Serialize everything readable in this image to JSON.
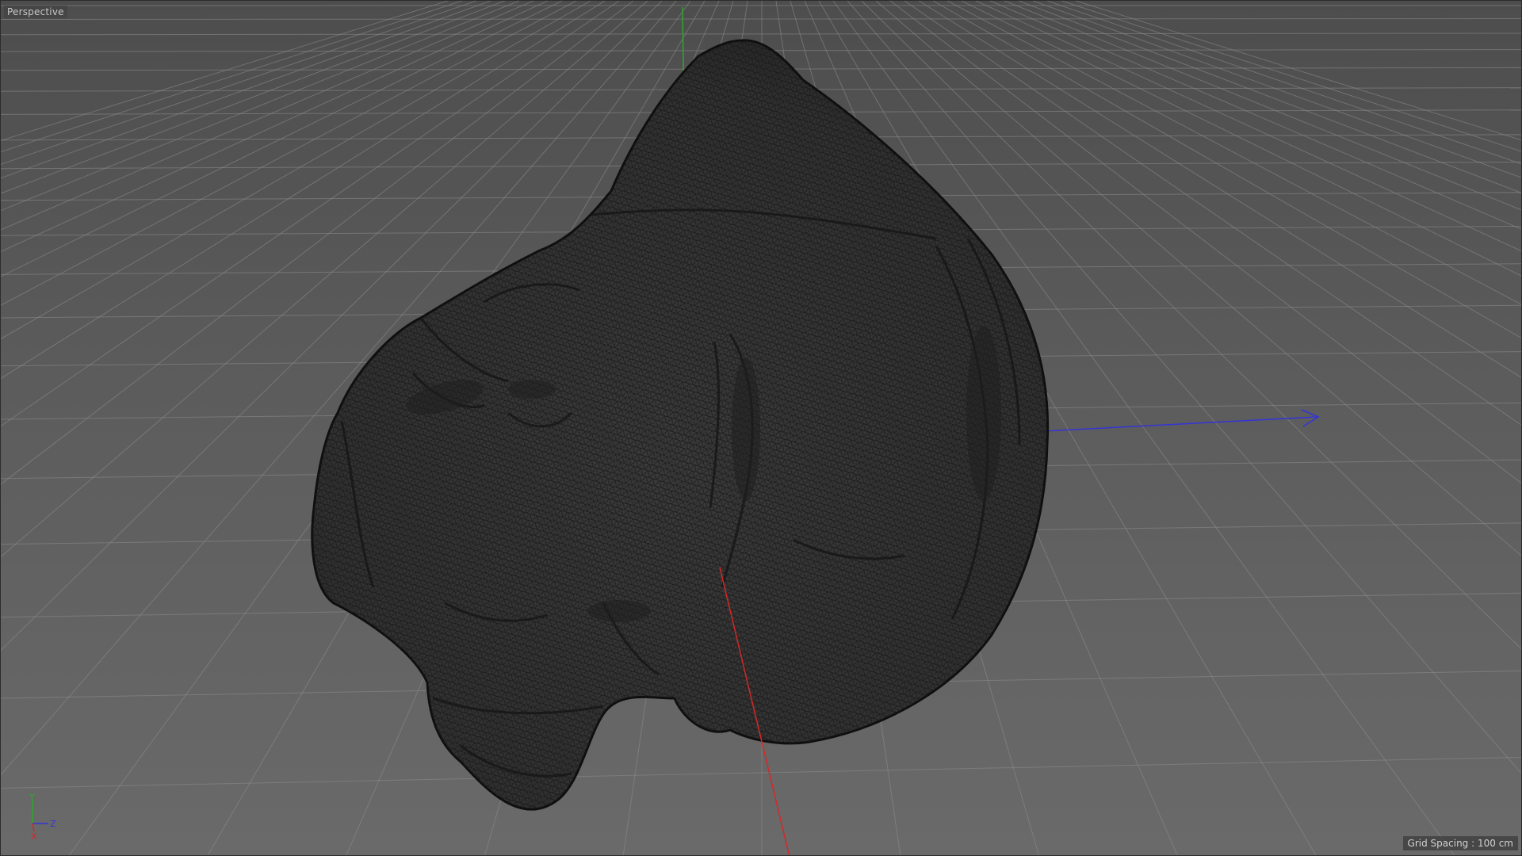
{
  "viewport": {
    "view_name": "Perspective",
    "grid_spacing_label": "Grid Spacing :",
    "grid_spacing_value": "100 cm",
    "object": "polygon-mesh-wireframe"
  },
  "axis_gizmo": {
    "y": "Y",
    "z": "Z",
    "x": "X"
  },
  "colors": {
    "grid_line": "#8e8e8e",
    "mesh_fill": "#2e2e2e",
    "mesh_wire": "#151515",
    "axis_x": "#d42828",
    "axis_y": "#2ea82e",
    "axis_z": "#3434d8"
  },
  "icons": [
    "axis-gizmo-icon"
  ]
}
